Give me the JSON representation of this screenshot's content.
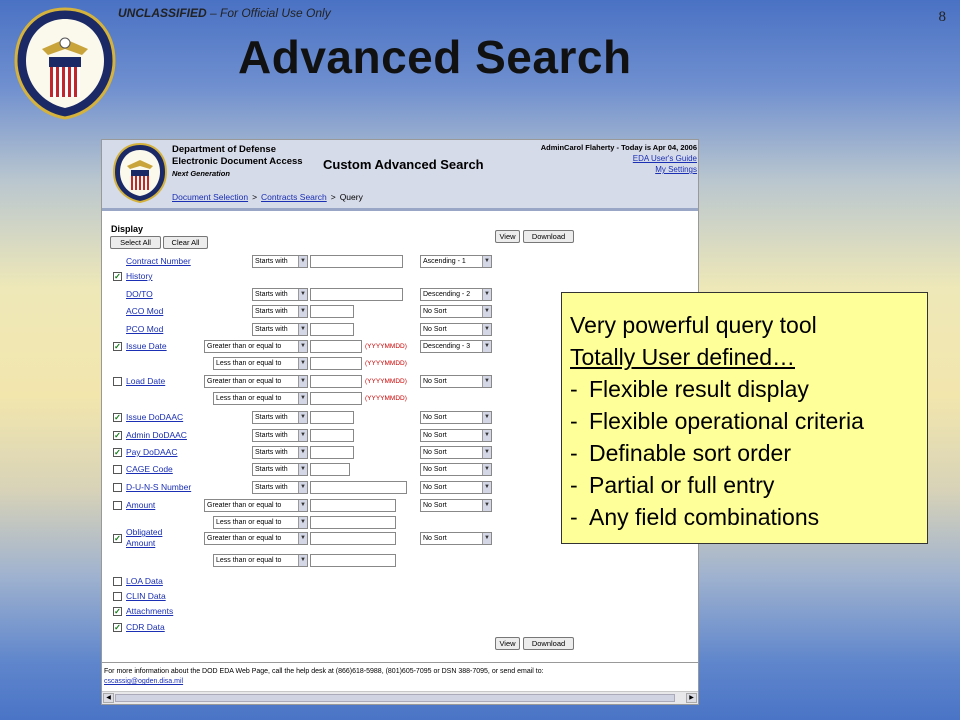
{
  "slide": {
    "classification_label": "UNCLASSIFIED",
    "classification_suffix": " – For Official Use Only",
    "page_number": "8",
    "title": "Advanced Search"
  },
  "app": {
    "org_lines": [
      "Department of Defense",
      "Electronic Document Access"
    ],
    "org_tagline": "Next Generation",
    "page_heading": "Custom Advanced Search",
    "user_status": "AdminCarol Flaherty - Today is Apr 04, 2006",
    "links": {
      "users_guide": "EDA User's Guide",
      "settings": "My Settings"
    },
    "breadcrumb": {
      "item1": "Document Selection",
      "sep": ">",
      "item2": "Contracts Search",
      "current": "Query"
    },
    "display_label": "Display",
    "buttons": {
      "select_all": "Select All",
      "clear_all": "Clear All",
      "view": "View",
      "download": "Download"
    },
    "date_hint": "(YYYYMMDD)",
    "fields": [
      {
        "label": "Contract Number",
        "checkbox": false,
        "checked": false,
        "op": "Starts with",
        "sort": "Ascending - 1"
      },
      {
        "label": "History",
        "checkbox": true,
        "checked": true
      },
      {
        "label": "DO/TO",
        "checkbox": false,
        "checked": false,
        "op": "Starts with",
        "sort": "Descending - 2"
      },
      {
        "label": "ACO Mod",
        "checkbox": false,
        "checked": false,
        "op": "Starts with",
        "sort": "No Sort"
      },
      {
        "label": "PCO Mod",
        "checkbox": false,
        "checked": false,
        "op": "Starts with",
        "sort": "No Sort"
      },
      {
        "label": "Issue Date",
        "checkbox": true,
        "checked": true,
        "op": "Greater than or equal to",
        "op2": "Less than or equal to",
        "sort": "Descending - 3"
      },
      {
        "label": "Load Date",
        "checkbox": true,
        "checked": false,
        "op": "Greater than or equal to",
        "op2": "Less than or equal to",
        "sort": "No Sort"
      },
      {
        "label": "Issue DoDAAC",
        "checkbox": true,
        "checked": true,
        "op": "Starts with",
        "sort": "No Sort"
      },
      {
        "label": "Admin DoDAAC",
        "checkbox": true,
        "checked": true,
        "op": "Starts with",
        "sort": "No Sort"
      },
      {
        "label": "Pay DoDAAC",
        "checkbox": true,
        "checked": true,
        "op": "Starts with",
        "sort": "No Sort"
      },
      {
        "label": "CAGE Code",
        "checkbox": true,
        "checked": false,
        "op": "Starts with",
        "sort": "No Sort"
      },
      {
        "label": "D-U-N-S Number",
        "checkbox": true,
        "checked": false,
        "op": "Starts with",
        "sort": "No Sort"
      },
      {
        "label": "Amount",
        "checkbox": true,
        "checked": false,
        "op": "Greater than or equal to",
        "op2": "Less than or equal to",
        "sort": "No Sort"
      },
      {
        "label": "Obligated Amount",
        "label_line1": "Obligated",
        "label_line2": "Amount",
        "checkbox": true,
        "checked": true,
        "op": "Greater than or equal to",
        "op2": "Less than or equal to",
        "sort": "No Sort"
      },
      {
        "label": "LOA Data",
        "checkbox": true,
        "checked": false
      },
      {
        "label": "CLIN Data",
        "checkbox": true,
        "checked": false
      },
      {
        "label": "Attachments",
        "checkbox": true,
        "checked": true
      },
      {
        "label": "CDR Data",
        "checkbox": true,
        "checked": true
      }
    ],
    "footer_text": "For more information about the DOD EDA Web Page, call the help desk at (866)618-5988, (801)605-7095 or DSN 388-7095, or send email to:",
    "footer_email": "cscassig@ogden.disa.mil"
  },
  "callout": {
    "line1": "Very powerful query tool",
    "line2": "Totally User defined…",
    "bullet_char": "-",
    "bullets": [
      "Flexible result display",
      "Flexible operational criteria",
      "Definable sort order",
      "Partial or full entry",
      "Any field combinations"
    ]
  },
  "colors": {
    "callout_bg": "#ffff99",
    "link": "#1a2fb4",
    "date_hint": "#d00000"
  }
}
